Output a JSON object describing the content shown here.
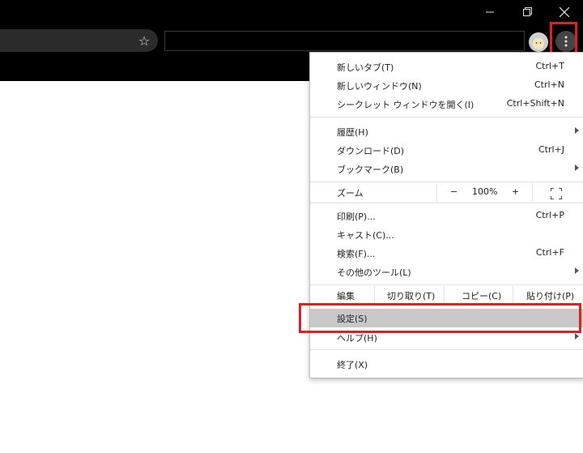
{
  "window": {
    "minimize_icon": "minimize-icon",
    "restore_icon": "restore-icon",
    "close_icon": "close-icon"
  },
  "toolbar": {
    "star_icon": "☆",
    "menu_icon": "vertical-ellipsis-icon"
  },
  "menu": {
    "new_tab": {
      "label": "新しいタブ(T)",
      "shortcut": "Ctrl+T"
    },
    "new_window": {
      "label": "新しいウィンドウ(N)",
      "shortcut": "Ctrl+N"
    },
    "incognito": {
      "label": "シークレット ウィンドウを開く(I)",
      "shortcut": "Ctrl+Shift+N"
    },
    "history": {
      "label": "履歴(H)"
    },
    "downloads": {
      "label": "ダウンロード(D)",
      "shortcut": "Ctrl+J"
    },
    "bookmarks": {
      "label": "ブックマーク(B)"
    },
    "zoom": {
      "label": "ズーム",
      "minus": "−",
      "value": "100%",
      "plus": "+"
    },
    "print": {
      "label": "印刷(P)...",
      "shortcut": "Ctrl+P"
    },
    "cast": {
      "label": "キャスト(C)..."
    },
    "find": {
      "label": "検索(F)...",
      "shortcut": "Ctrl+F"
    },
    "more_tools": {
      "label": "その他のツール(L)"
    },
    "edit": {
      "label": "編集",
      "cut": "切り取り(T)",
      "copy": "コピー(C)",
      "paste": "貼り付け(P)"
    },
    "settings": {
      "label": "設定(S)"
    },
    "help": {
      "label": "ヘルプ(H)"
    },
    "exit": {
      "label": "終了(X)"
    }
  },
  "colors": {
    "highlight_box": "#e02020",
    "hover_row": "#c8c8c8",
    "chrome_bg": "#000000"
  }
}
